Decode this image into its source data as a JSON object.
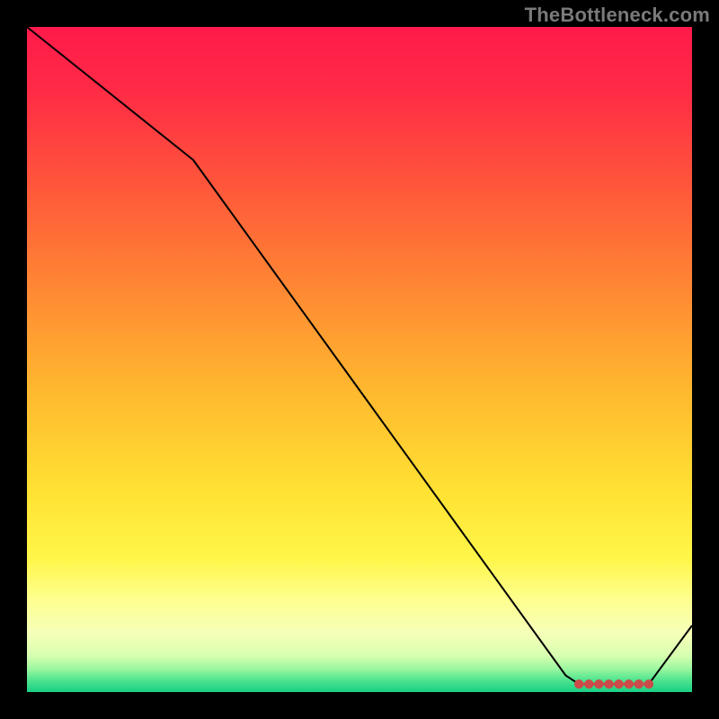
{
  "watermark": "TheBottleneck.com",
  "chart_data": {
    "type": "line",
    "title": "",
    "xlabel": "",
    "ylabel": "",
    "xlim": [
      0,
      100
    ],
    "ylim": [
      0,
      100
    ],
    "x": [
      0,
      25,
      81,
      83,
      84.5,
      86,
      87.5,
      89,
      90.5,
      92,
      93.5,
      100
    ],
    "values": [
      100,
      80,
      2.5,
      1.2,
      1.2,
      1.2,
      1.2,
      1.2,
      1.2,
      1.2,
      1.2,
      10
    ],
    "series": [
      {
        "name": "curve",
        "color": "#000000"
      }
    ],
    "marker_x": [
      83,
      84.5,
      86,
      87.5,
      89,
      90.5,
      92,
      93.5
    ],
    "marker_value": 1.2,
    "marker_color": "#cc4a49",
    "background_gradient": {
      "stops": [
        {
          "offset": 0.0,
          "color": "#ff1a4b"
        },
        {
          "offset": 0.1,
          "color": "#ff2c45"
        },
        {
          "offset": 0.25,
          "color": "#ff5a3a"
        },
        {
          "offset": 0.4,
          "color": "#ff8a33"
        },
        {
          "offset": 0.55,
          "color": "#ffb92f"
        },
        {
          "offset": 0.7,
          "color": "#ffe233"
        },
        {
          "offset": 0.8,
          "color": "#fff64a"
        },
        {
          "offset": 0.86,
          "color": "#feff8e"
        },
        {
          "offset": 0.91,
          "color": "#f6ffb8"
        },
        {
          "offset": 0.945,
          "color": "#d8ffb0"
        },
        {
          "offset": 0.965,
          "color": "#9cf7a0"
        },
        {
          "offset": 0.982,
          "color": "#4fe48f"
        },
        {
          "offset": 1.0,
          "color": "#18d084"
        }
      ]
    }
  }
}
